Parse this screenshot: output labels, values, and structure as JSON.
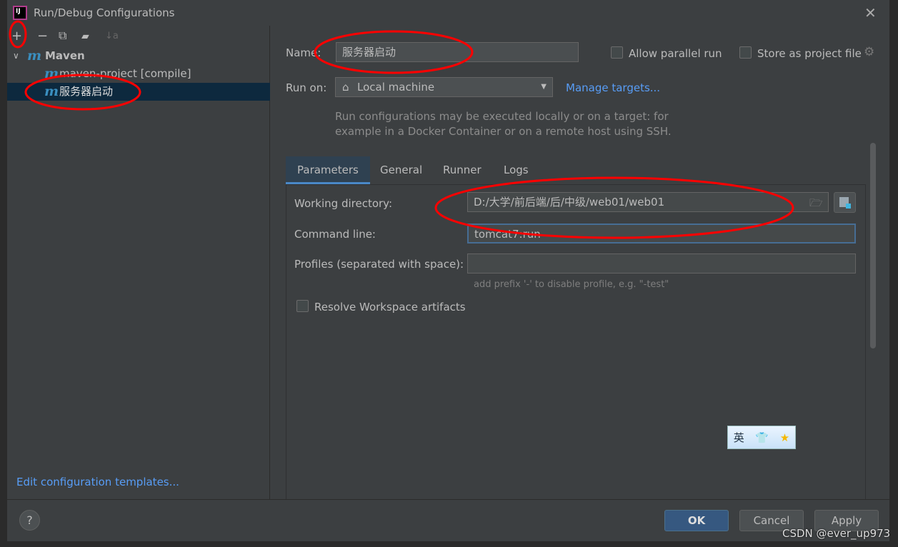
{
  "window": {
    "title": "Run/Debug Configurations"
  },
  "toolbar": {
    "add": "+",
    "remove": "−",
    "copy": "⧉",
    "folder": "▰",
    "sort": "↓a"
  },
  "tree": {
    "group": "Maven",
    "items": [
      {
        "label": "maven-project [compile]",
        "selected": false
      },
      {
        "label": "服务器启动",
        "selected": true
      }
    ]
  },
  "left": {
    "edit_templates": "Edit configuration templates..."
  },
  "form": {
    "name_label": "Name:",
    "name_value": "服务器启动",
    "allow_parallel": "Allow parallel run",
    "store_project": "Store as project file",
    "run_on_label": "Run on:",
    "run_on_value": "Local machine",
    "manage_targets": "Manage targets...",
    "run_on_hint_1": "Run configurations may be executed locally or on a target: for",
    "run_on_hint_2": "example in a Docker Container or on a remote host using SSH."
  },
  "tabs": [
    {
      "label": "Parameters",
      "active": true
    },
    {
      "label": "General"
    },
    {
      "label": "Runner"
    },
    {
      "label": "Logs"
    }
  ],
  "params": {
    "workdir_label": "Working directory:",
    "workdir_value": "D:/大学/前后端/后/中级/web01/web01",
    "cmd_label": "Command line:",
    "cmd_value": "tomcat7:run",
    "profiles_label": "Profiles (separated with space):",
    "profiles_value": "",
    "profiles_hint": "add prefix '-' to disable profile, e.g. \"-test\"",
    "resolve_workspace": "Resolve Workspace artifacts"
  },
  "ime": {
    "lang": "英"
  },
  "footer": {
    "help": "?",
    "ok": "OK",
    "cancel": "Cancel",
    "apply": "Apply"
  },
  "watermark": "CSDN @ever_up973",
  "colors": {
    "accent": "#365880",
    "link": "#589df6",
    "annotation": "#ff0000",
    "selection": "#0d293e"
  }
}
